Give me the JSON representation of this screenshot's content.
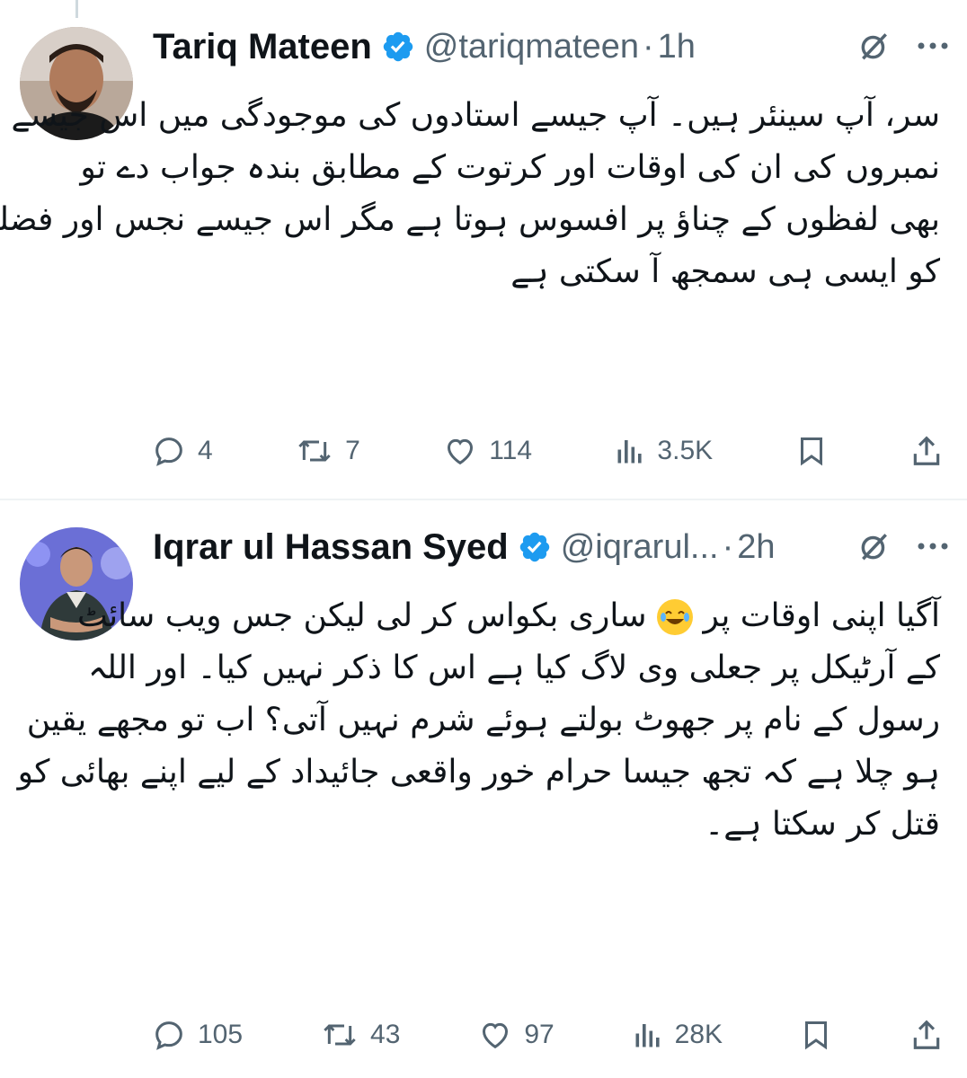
{
  "tweets": [
    {
      "author": "Tariq Mateen",
      "handle": "@tariqmateen",
      "separator": "·",
      "time": "1h",
      "body_lines": [
        "سر، آپ سینئر ہیں۔ آپ جیسے استادوں کی موجودگی میں اس جیسے تین",
        "نمبروں کی ان کی اوقات اور کرتوت کے مطابق بندہ جواب دے تو",
        "بھی لفظوں کے چناؤ پر افسوس ہوتا ہے مگر اس جیسے نجس اور فضلے",
        "کو ایسی ہی سمجھ آ سکتی ہے"
      ],
      "stats": {
        "replies": "4",
        "reposts": "7",
        "likes": "114",
        "views": "3.5K"
      },
      "icons": [
        "verified-badge-icon",
        "grok-icon",
        "more-icon",
        "reply-icon",
        "repost-icon",
        "like-icon",
        "views-icon",
        "bookmark-icon",
        "share-icon"
      ]
    },
    {
      "author": "Iqrar ul Hassan Syed",
      "handle": "@iqrarul...",
      "separator": "·",
      "time": "2h",
      "body_lines_pre_emoji": "آگیا اپنی اوقات پر",
      "body_lines_post_emoji": "ساری بکواس کر لی لیکن جس ویب سائٹ",
      "body_lines": [
        "کے آرٹیکل پر جعلی وی لاگ کیا ہے اس کا ذکر نہیں کیا۔ اور اللہ",
        "رسول کے نام پر جھوٹ بولتے ہوئے شرم نہیں آتی؟ اب تو مجھے یقین",
        "ہو چلا ہے کہ تجھ جیسا حرام خور واقعی جائیداد کے لیے اپنے بھائی کو",
        "قتل کر سکتا ہے۔"
      ],
      "stats": {
        "replies": "105",
        "reposts": "43",
        "likes": "97",
        "views": "28K"
      },
      "icons": [
        "laughing-emoji-icon"
      ]
    }
  ],
  "colors": {
    "text": "#0f1419",
    "muted": "#536471",
    "verified": "#1d9bf0",
    "divider": "#eff3f4"
  }
}
